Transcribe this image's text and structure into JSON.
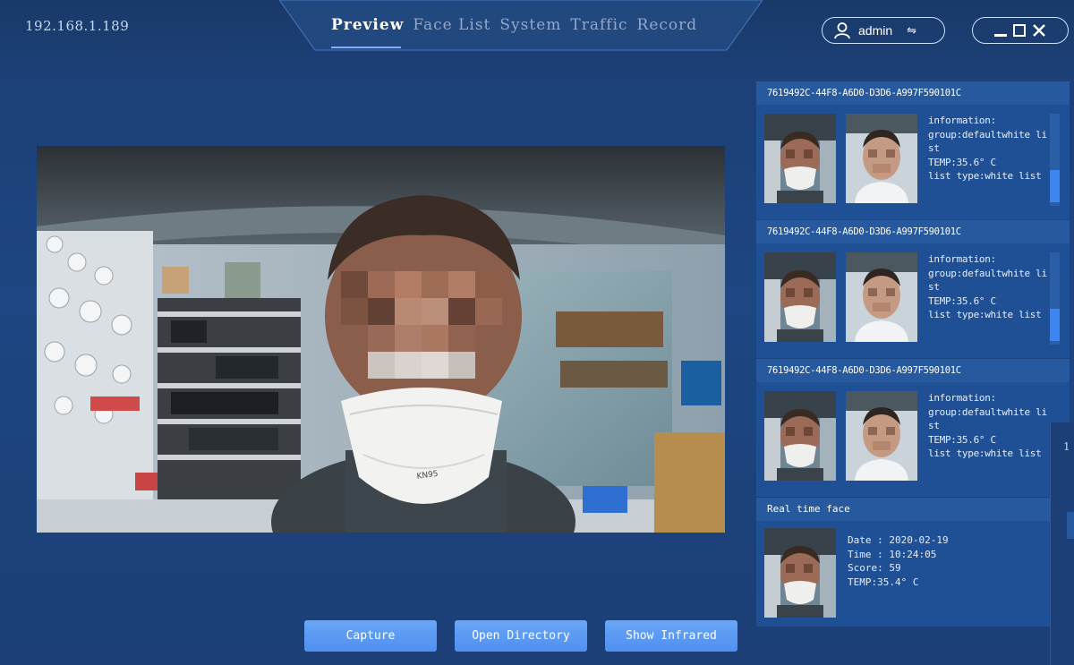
{
  "header": {
    "ip": "192.168.1.189",
    "tabs": [
      {
        "label": "Preview",
        "active": true
      },
      {
        "label": "Face List",
        "active": false
      },
      {
        "label": "System",
        "active": false
      },
      {
        "label": "Traffic",
        "active": false
      },
      {
        "label": "Record",
        "active": false
      }
    ],
    "user": "admin",
    "switch_symbol": "⇋"
  },
  "buttons": {
    "capture": "Capture",
    "open_directory": "Open Directory",
    "show_infrared": "Show Infrared"
  },
  "records": [
    {
      "id": "7619492C-44F8-A6D0-D3D6-A997F590101C",
      "info": "information:\ngroup:defaultwhite list\nTEMP:35.6° C\nlist type:white list"
    },
    {
      "id": "7619492C-44F8-A6D0-D3D6-A997F590101C",
      "info": "information:\ngroup:defaultwhite list\nTEMP:35.6° C\nlist type:white list"
    },
    {
      "id": "7619492C-44F8-A6D0-D3D6-A997F590101C",
      "info": "information:\ngroup:defaultwhite list\nTEMP:35.6° C\nlist type:white list"
    }
  ],
  "realtime": {
    "title": "Real time face",
    "date": "Date : 2020-02-19",
    "time": "Time : 10:24:05",
    "score": "Score: 59",
    "temp": "TEMP:35.4° C"
  },
  "edge": {
    "num": "1"
  },
  "colors": {
    "accent": "#4f8ff0",
    "card": "#1f4f94",
    "card_header": "#27599f",
    "background": "#1d4682"
  },
  "icons": {
    "user": "user-icon",
    "swap": "swap-icon",
    "minimize": "minimize-icon",
    "maximize": "maximize-icon",
    "close": "close-icon"
  }
}
